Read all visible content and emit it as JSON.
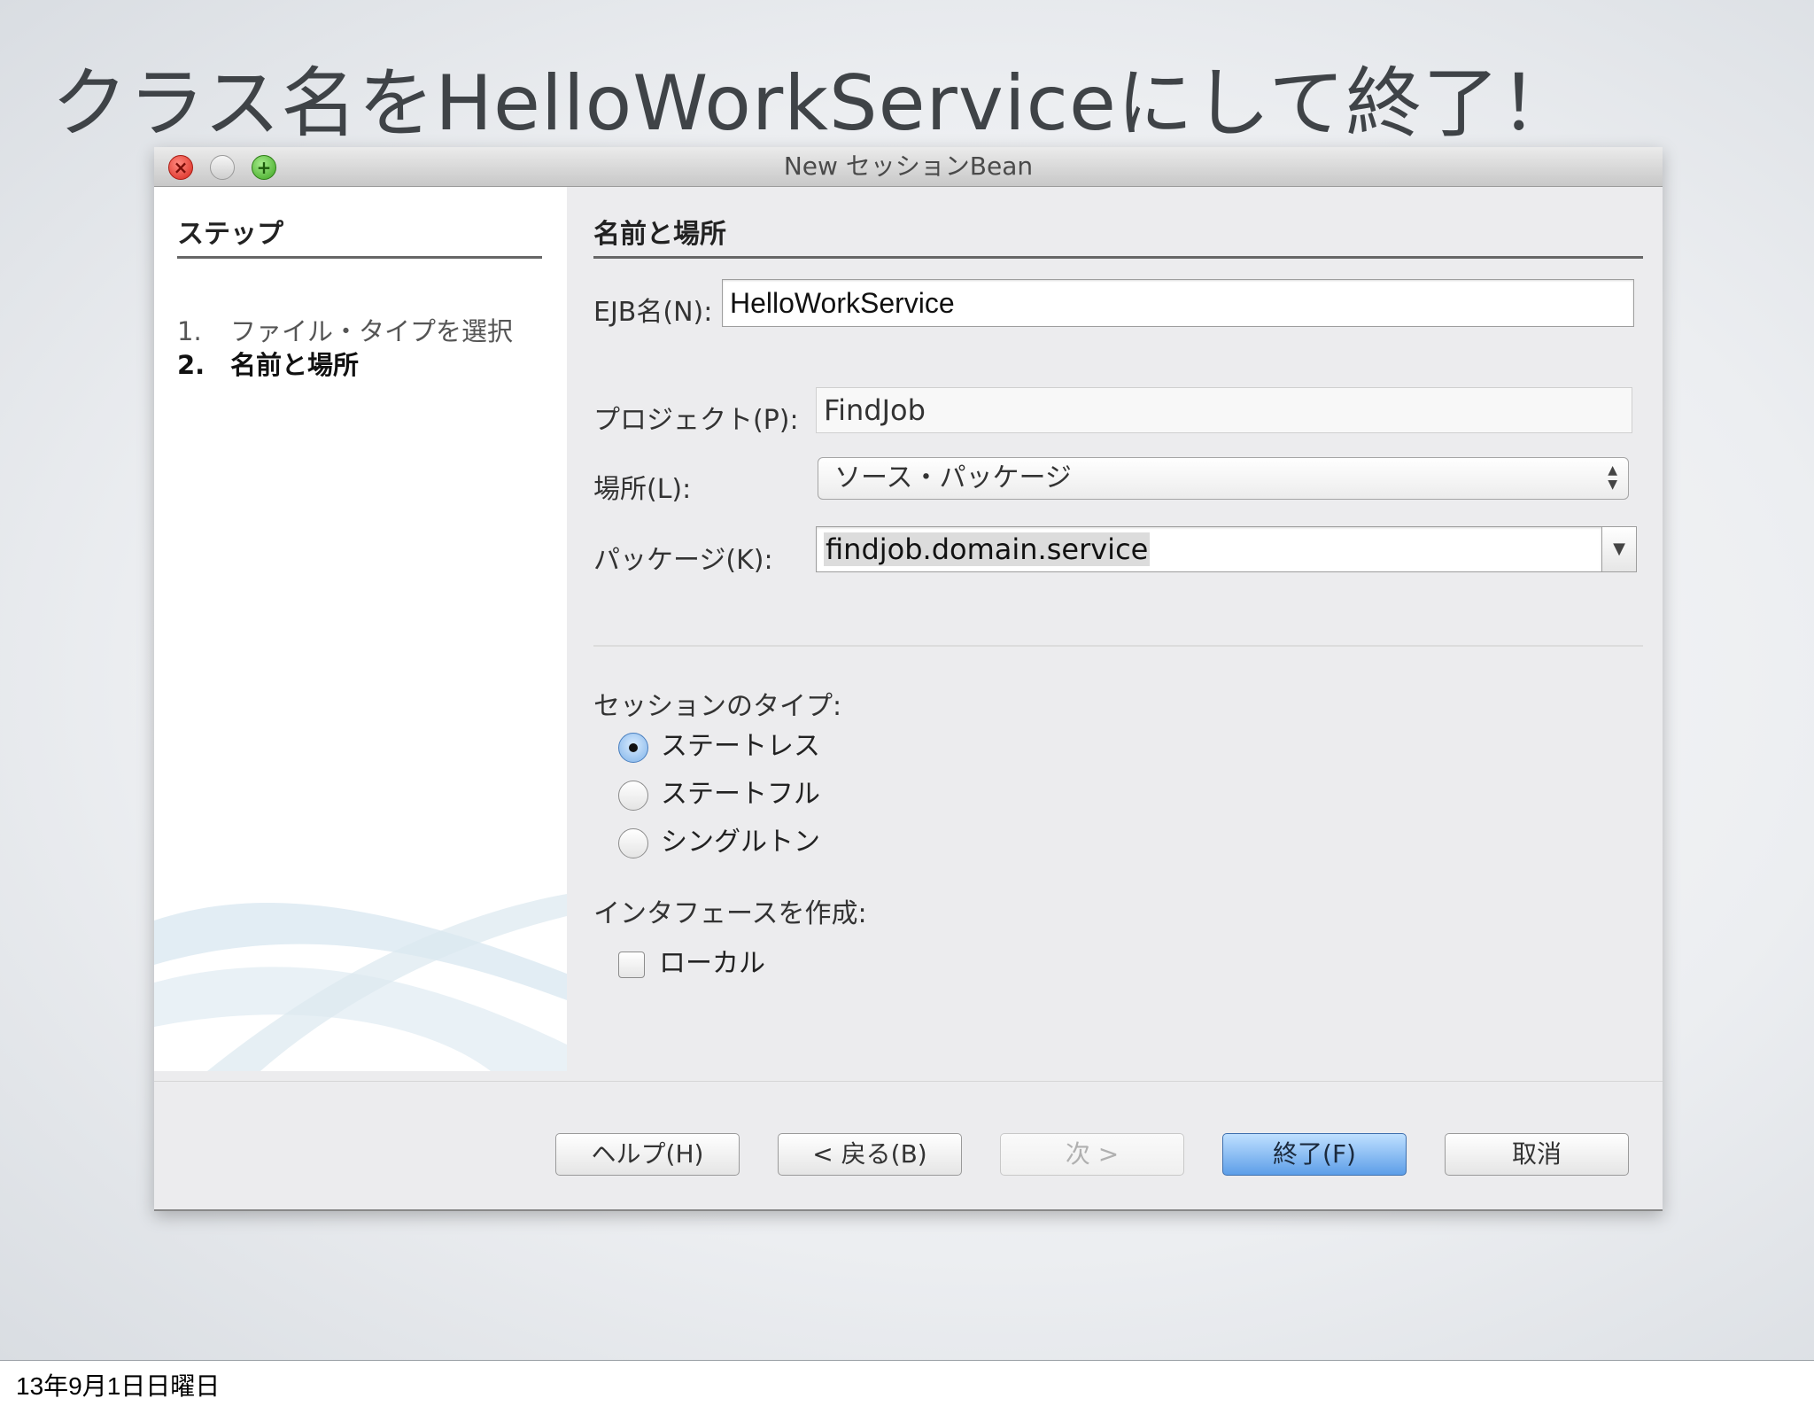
{
  "slide": {
    "title": "クラス名をHelloWorkServiceにして終了！",
    "footer_date": "13年9月1日日曜日"
  },
  "window": {
    "title": "New セッションBean"
  },
  "steps": {
    "heading": "ステップ",
    "items": [
      {
        "num": "1.",
        "label": "ファイル・タイプを選択"
      },
      {
        "num": "2.",
        "label": "名前と場所"
      }
    ]
  },
  "form": {
    "heading": "名前と場所",
    "ejb_label": "EJB名(N):",
    "ejb_value": "HelloWorkService",
    "project_label": "プロジェクト(P):",
    "project_value": "FindJob",
    "location_label": "場所(L):",
    "location_value": "ソース・パッケージ",
    "package_label": "パッケージ(K):",
    "package_value": "findjob.domain.service",
    "session_type_label": "セッションのタイプ:",
    "session_types": [
      {
        "label": "ステートレス",
        "checked": true
      },
      {
        "label": "ステートフル",
        "checked": false
      },
      {
        "label": "シングルトン",
        "checked": false
      }
    ],
    "interface_label": "インタフェースを作成:",
    "local_label": "ローカル",
    "local_checked": false
  },
  "buttons": {
    "help": "ヘルプ(H)",
    "back": "< 戻る(B)",
    "next": "次 >",
    "finish": "終了(F)",
    "cancel": "取消"
  },
  "icons": {
    "window_close": "close-icon",
    "window_minimize": "minimize-icon",
    "window_zoom": "zoom-icon",
    "location_arrows": "updown-arrows-icon",
    "package_dropdown": "chevron-down-icon"
  },
  "colors": {
    "accent": "#5d9ee8",
    "close": "#d8261c",
    "zoom": "#3ca51f"
  }
}
